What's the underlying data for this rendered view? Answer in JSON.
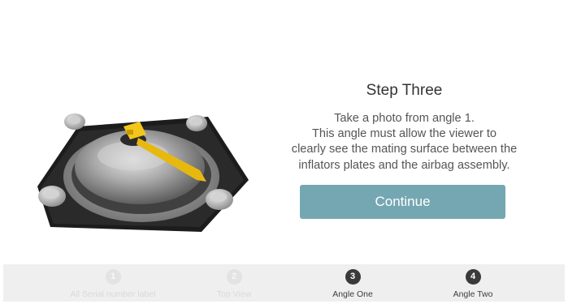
{
  "step": {
    "title": "Step Three",
    "instruction_lines": [
      "Take a photo from angle 1.",
      "This angle must allow the viewer to",
      "clearly see the mating surface between the",
      "inflators plates and the airbag assembly."
    ],
    "continue_label": "Continue"
  },
  "stepper": {
    "items": [
      {
        "number": "1",
        "label": "All Serial number label",
        "state": "done"
      },
      {
        "number": "2",
        "label": "Top View",
        "state": "done"
      },
      {
        "number": "3",
        "label": "Angle One",
        "state": "current"
      },
      {
        "number": "4",
        "label": "Angle Two",
        "state": "upcoming"
      }
    ]
  },
  "colors": {
    "continue_button": "#75a7b2",
    "stepper_bar": "#efefef",
    "active_step": "#3a3a3a",
    "inactive_step": "#e3e3e3",
    "tag": "#f2c61b"
  },
  "illustration": {
    "icon": "airbag-inflator-assembly-photo"
  }
}
